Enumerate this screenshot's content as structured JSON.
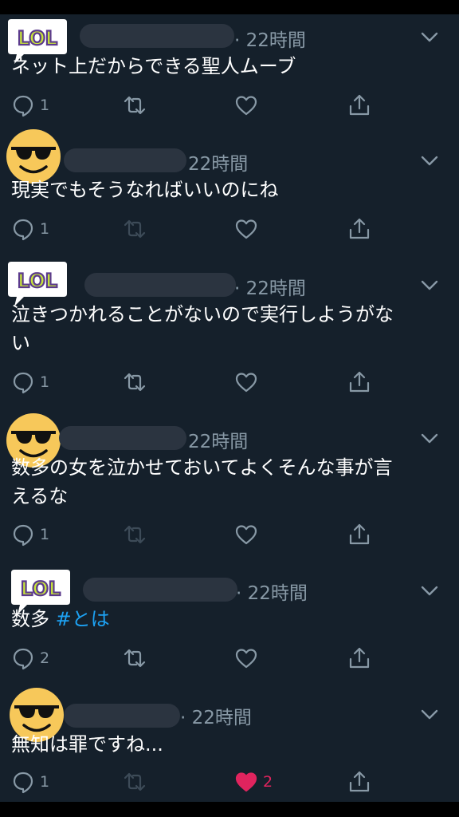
{
  "tweets": [
    {
      "avatar": "lol-sticker-avatar",
      "time": "· 22時間",
      "text": "ネット上だからできる聖人ムーブ",
      "replies": "1",
      "retweets": "",
      "likes": "",
      "liked": false
    },
    {
      "avatar": "sunglasses-smiley-avatar",
      "time": "22時間",
      "text": "現実でもそうなればいいのにね",
      "replies": "1",
      "retweets": "",
      "likes": "",
      "liked": false
    },
    {
      "avatar": "lol-sticker-avatar",
      "time": "· 22時間",
      "text": "泣きつかれることがないので実行しようがな\nい",
      "replies": "1",
      "retweets": "",
      "likes": "",
      "liked": false
    },
    {
      "avatar": "sunglasses-smiley-avatar",
      "time": "22時間",
      "text": "数多の女を泣かせておいてよくそんな事が言\nえるな",
      "replies": "1",
      "retweets": "",
      "likes": "",
      "liked": false
    },
    {
      "avatar": "lol-sticker-avatar",
      "time": "· 22時間",
      "text": "数多 ",
      "hashtag": "#とは",
      "replies": "2",
      "retweets": "",
      "likes": "",
      "liked": false
    },
    {
      "avatar": "sunglasses-smiley-avatar",
      "time": "· 22時間",
      "text": "無知は罪ですね...",
      "replies": "1",
      "retweets": "",
      "likes": "2",
      "liked": true
    }
  ],
  "colors": {
    "background": "#15202b",
    "text": "#ffffff",
    "secondary": "#8899a6",
    "link": "#1da1f2",
    "like": "#e0245e"
  },
  "sticker_text": "LOL"
}
